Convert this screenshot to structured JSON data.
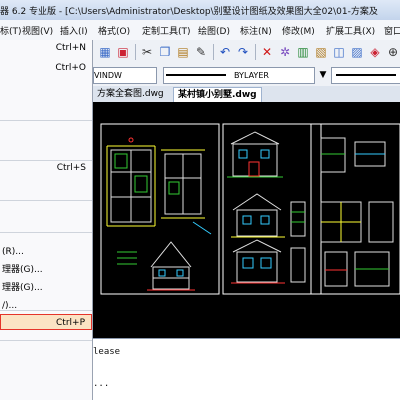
{
  "window": {
    "title": "器 6.2 专业版 - [C:\\Users\\Administrator\\Desktop\\别墅设计图纸及效果图大全02\\01-方案及"
  },
  "menubar": [
    {
      "label": "标(T)"
    },
    {
      "label": "视图(V)"
    },
    {
      "label": "插入(I)"
    },
    {
      "label": "格式(O)"
    },
    {
      "label": "定制工具(T)"
    },
    {
      "label": "绘图(D)"
    },
    {
      "label": "标注(N)"
    },
    {
      "label": "修改(M)"
    },
    {
      "label": "扩展工具(X)"
    },
    {
      "label": "窗口"
    }
  ],
  "toolbar": {
    "layer_combo": "VINDW",
    "linetype_combo": "BYLAYER"
  },
  "tabs": [
    {
      "label": "方案全套图.dwg"
    },
    {
      "label": "某村镇小别墅.dwg",
      "active": true
    }
  ],
  "file_menu": {
    "items": [
      {
        "label": "",
        "shortcut": "Ctrl+N"
      },
      {
        "label": "",
        "shortcut": "Ctrl+O"
      },
      {
        "label": "",
        "shortcut": "Ctrl+S"
      },
      {
        "label": "(R)...",
        "shortcut": ""
      },
      {
        "label": "理器(G)...",
        "shortcut": ""
      },
      {
        "label": "理器(G)...",
        "shortcut": ""
      },
      {
        "label": "/)...",
        "shortcut": ""
      },
      {
        "label": "",
        "shortcut": "Ctrl+P",
        "highlighted": true
      }
    ]
  },
  "command_line": {
    "line1": "lease",
    "line2": "..."
  }
}
